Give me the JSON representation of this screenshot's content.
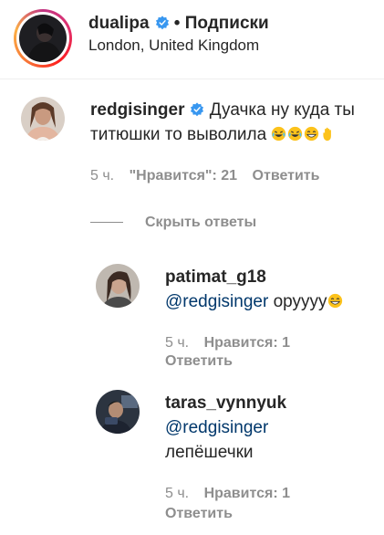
{
  "header": {
    "username": "dualipa",
    "separator": "•",
    "follow_label": "Подписки",
    "location": "London, United Kingdom"
  },
  "comment": {
    "username": "redgisinger",
    "text": "Дуачка ну куда ты титюшки то выволила",
    "emojis": [
      "laughing-crying-emoji",
      "laughing-crying-emoji",
      "grinning-emoji",
      "hand-emoji"
    ],
    "time": "5 ч.",
    "likes": "\"Нравится\": 21",
    "reply_label": "Ответить"
  },
  "hide_replies_label": "Скрыть ответы",
  "replies": [
    {
      "username": "patimat_g18",
      "mention": "@redgisinger",
      "text": "оруууу",
      "emojis": [
        "grinning-emoji"
      ],
      "time": "5 ч.",
      "likes": "Нравится: 1",
      "reply_label": "Ответить"
    },
    {
      "username": "taras_vynnyuk",
      "mention": "@redgisinger",
      "text": "лепёшечки",
      "time": "5 ч.",
      "likes": "Нравится: 1",
      "reply_label": "Ответить"
    }
  ],
  "colors": {
    "text": "#262626",
    "secondary": "#8e8e8e",
    "mention": "#00376b",
    "verified": "#3897f0"
  }
}
